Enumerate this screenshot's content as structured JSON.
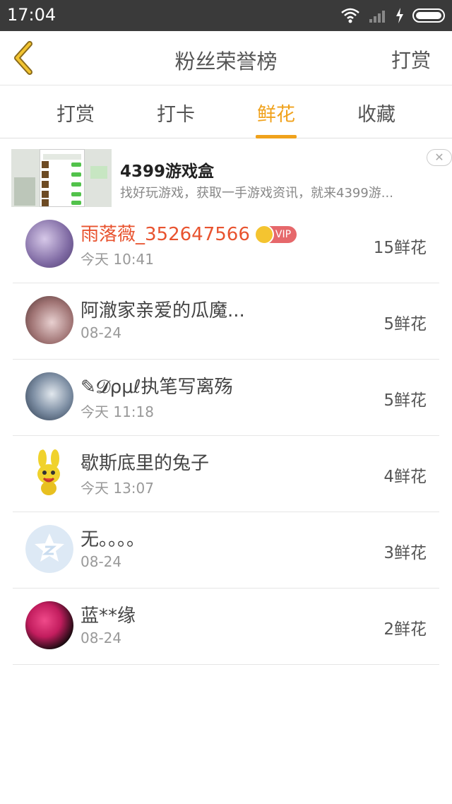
{
  "statusbar": {
    "time": "17:04"
  },
  "nav": {
    "title": "粉丝荣誉榜",
    "right_action": "打赏"
  },
  "tabs": [
    {
      "label": "打赏",
      "active": false
    },
    {
      "label": "打卡",
      "active": false
    },
    {
      "label": "鲜花",
      "active": true
    },
    {
      "label": "收藏",
      "active": false
    }
  ],
  "ad": {
    "title": "4399游戏盒",
    "description": "找好玩游戏，获取一手游戏资讯，就来4399游..."
  },
  "list": [
    {
      "name": "雨落薇_352647566",
      "vip": true,
      "vip_label": "VIP",
      "time": "今天 10:41",
      "count": "15鲜花"
    },
    {
      "name": "阿澈家亲爱的瓜魔...",
      "vip": false,
      "time": "08-24",
      "count": "5鲜花"
    },
    {
      "name": "✎𝓓ρμℓ执笔写离殇",
      "vip": false,
      "time": "今天 11:18",
      "count": "5鲜花"
    },
    {
      "name": "歇斯底里的兔子",
      "vip": false,
      "time": "今天 13:07",
      "count": "4鲜花"
    },
    {
      "name": "无。。。。",
      "vip": false,
      "time": "08-24",
      "count": "3鲜花"
    },
    {
      "name": "蓝**缘",
      "vip": false,
      "time": "08-24",
      "count": "2鲜花"
    }
  ],
  "colors": {
    "accent": "#f0a21c",
    "vip_name": "#e8532f",
    "statusbar": "#3a3a3a"
  }
}
